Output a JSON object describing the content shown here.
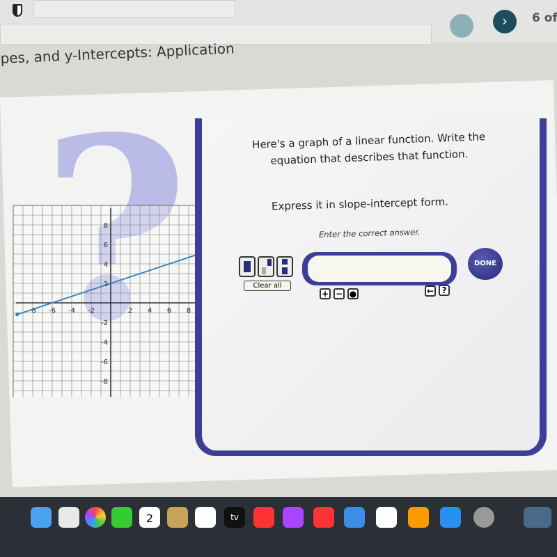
{
  "header": {
    "title": "pes, and y-Intercepts: Application",
    "progress": "6 of"
  },
  "question": {
    "prompt": "Here's a graph of a linear function. Write the equation that describes that function.",
    "instruction": "Express it in slope-intercept form.",
    "hint": "Enter the correct answer.",
    "answer_value": "",
    "clear_label": "Clear all",
    "done_label": "DONE",
    "keys": [
      "+",
      "−",
      "●",
      "←",
      "?"
    ]
  },
  "graph": {
    "x_ticks": [
      "-8",
      "-6",
      "-4",
      "-2",
      "2",
      "4",
      "6",
      "8"
    ],
    "y_ticks": [
      "8",
      "6",
      "4",
      "2",
      "-2",
      "-4",
      "-6",
      "-8"
    ],
    "range": [
      -10,
      10
    ],
    "line_color": "#2a7fc0",
    "line": {
      "y_intercept": 2,
      "slope": 0.333
    }
  },
  "dock": {
    "calendar_day": "2",
    "tv_label": "tv"
  }
}
